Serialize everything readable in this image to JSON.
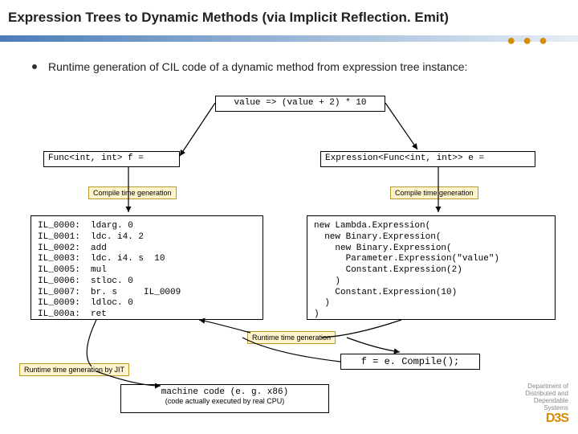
{
  "title": "Expression Trees to Dynamic Methods (via Implicit Reflection. Emit)",
  "bullet": "Runtime generation of CIL code of a dynamic method from expression tree instance:",
  "lambda_box": "value => (value + 2) * 10",
  "func_decl": "Func<int, int> f =",
  "expr_decl": "Expression<Func<int, int>> e =",
  "badges": {
    "compile_time": "Compile time generation",
    "runtime": "Runtime time generation",
    "runtime_jit": "Runtime time generation by JIT"
  },
  "il_code": "IL_0000:  ldarg. 0\nIL_0001:  ldc. i4. 2\nIL_0002:  add\nIL_0003:  ldc. i4. s  10\nIL_0005:  mul\nIL_0006:  stloc. 0\nIL_0007:  br. s     IL_0009\nIL_0009:  ldloc. 0\nIL_000a:  ret",
  "expr_code": "new Lambda.Expression(\n  new Binary.Expression(\n    new Binary.Expression(\n      Parameter.Expression(\"value\")\n      Constant.Expression(2)\n    )\n    Constant.Expression(10)\n  )\n)",
  "compile_stmt": "f = e. Compile();",
  "machine": {
    "line1": "machine code (e. g. x86)",
    "line2": "(code actually executed by real CPU)"
  },
  "logo": {
    "l1": "Department of",
    "l2": "Distributed and",
    "l3": "Dependable",
    "l4": "Systems",
    "brand": "D3S"
  }
}
